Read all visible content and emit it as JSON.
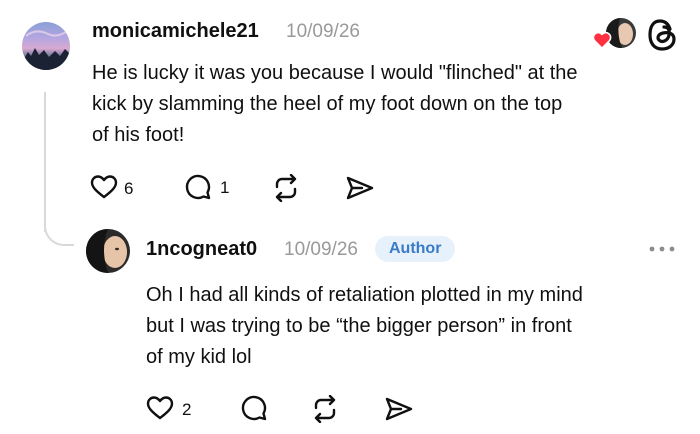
{
  "comment": {
    "username": "monicamichele21",
    "date": "10/09/26",
    "lines": [
      "He is lucky it was you because I would \"flinched\" at the",
      "kick by slamming the heel of my foot down on the top",
      "of his foot!"
    ],
    "likes": "6",
    "replies": "1"
  },
  "reply": {
    "username": "1ncogneat0",
    "date": "10/09/26",
    "badge": "Author",
    "lines": [
      "Oh I had all kinds of retaliation plotted in my mind",
      "but I was trying to be “the bigger person” in front",
      "of my kid lol"
    ],
    "likes": "2"
  },
  "colors": {
    "like": "#ff3040",
    "badge_bg": "#e7f1fb",
    "badge_text": "#3a7bc8"
  },
  "icons": [
    "heart-icon",
    "comment-icon",
    "repost-icon",
    "share-icon",
    "threads-logo-icon",
    "more-icon"
  ]
}
